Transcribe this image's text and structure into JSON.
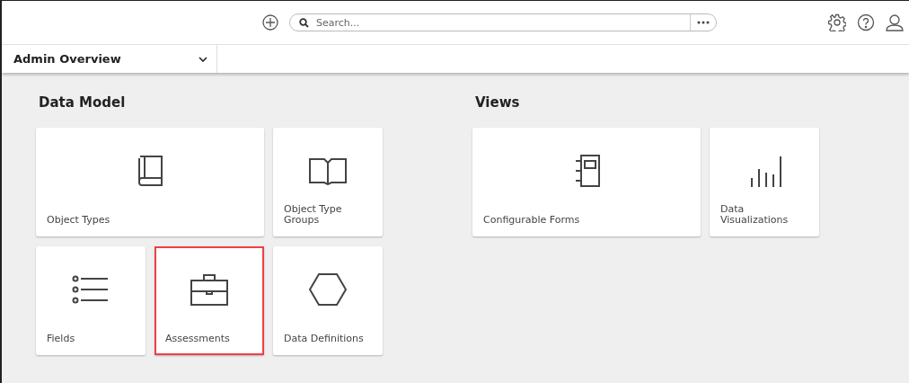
{
  "header": {
    "search": {
      "placeholder": "Search..."
    }
  },
  "tab": {
    "label": "Admin Overview"
  },
  "sections": [
    {
      "title": "Data Model",
      "cards": [
        {
          "label": "Object Types",
          "kind": "book",
          "wide": true,
          "highlighted": false
        },
        {
          "label": "Object Type Groups",
          "kind": "openbook",
          "wide": false,
          "highlighted": false
        },
        {
          "label": "Fields",
          "kind": "list",
          "wide": false,
          "highlighted": false
        },
        {
          "label": "Assessments",
          "kind": "briefcase",
          "wide": false,
          "highlighted": true
        },
        {
          "label": "Data Definitions",
          "kind": "hexagon",
          "wide": false,
          "highlighted": false
        }
      ]
    },
    {
      "title": "Views",
      "cards": [
        {
          "label": "Configurable Forms",
          "kind": "notebook",
          "wide": true,
          "highlighted": false
        },
        {
          "label": "Data Visualizations",
          "kind": "bars",
          "wide": false,
          "highlighted": false
        }
      ]
    }
  ]
}
